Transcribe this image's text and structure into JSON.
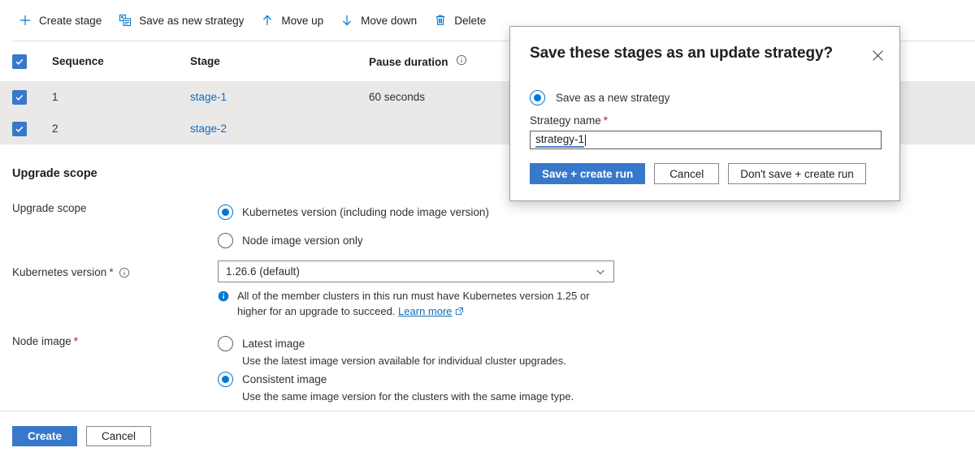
{
  "toolbar": {
    "items": [
      {
        "label": "Create stage",
        "icon": "plus-icon"
      },
      {
        "label": "Save as new strategy",
        "icon": "save-copy-icon"
      },
      {
        "label": "Move up",
        "icon": "arrow-up-icon"
      },
      {
        "label": "Move down",
        "icon": "arrow-down-icon"
      },
      {
        "label": "Delete",
        "icon": "trash-icon"
      }
    ]
  },
  "table": {
    "columns": {
      "sequence": "Sequence",
      "stage": "Stage",
      "pause_duration": "Pause duration"
    },
    "rows": [
      {
        "selected": true,
        "sequence": "1",
        "stage": "stage-1",
        "pause_duration": "60 seconds"
      },
      {
        "selected": true,
        "sequence": "2",
        "stage": "stage-2",
        "pause_duration": ""
      }
    ]
  },
  "upgrade_scope": {
    "section_title": "Upgrade scope",
    "scope_label": "Upgrade scope",
    "scope_options": [
      {
        "label": "Kubernetes version (including node image version)",
        "selected": true
      },
      {
        "label": "Node image version only",
        "selected": false
      }
    ],
    "kubernetes_version_label": "Kubernetes version",
    "kubernetes_version_value": "1.26.6 (default)",
    "hint_text_1": "All of the member clusters in this run must have Kubernetes version 1.25 or",
    "hint_text_2": "higher for an upgrade to succeed.",
    "hint_link": "Learn more",
    "node_image_label": "Node image",
    "node_image_options": [
      {
        "label": "Latest image",
        "description": "Use the latest image version available for individual cluster upgrades.",
        "selected": false
      },
      {
        "label": "Consistent image",
        "description": "Use the same image version for the clusters with the same image type.",
        "selected": true
      }
    ]
  },
  "footer": {
    "create_label": "Create",
    "cancel_label": "Cancel"
  },
  "modal": {
    "title": "Save these stages as an update strategy?",
    "radio_label": "Save as a new strategy",
    "radio_selected": true,
    "field_label": "Strategy name",
    "input_value": "strategy-1",
    "buttons": {
      "save_create": "Save + create run",
      "cancel": "Cancel",
      "dont_save": "Don't save + create run"
    }
  },
  "colors": {
    "accent": "#0078d4",
    "primary_button": "#3878ca",
    "link": "#0f6cbd",
    "required_star": "#a4262c",
    "row_selected_bg": "#ebe9e7"
  }
}
